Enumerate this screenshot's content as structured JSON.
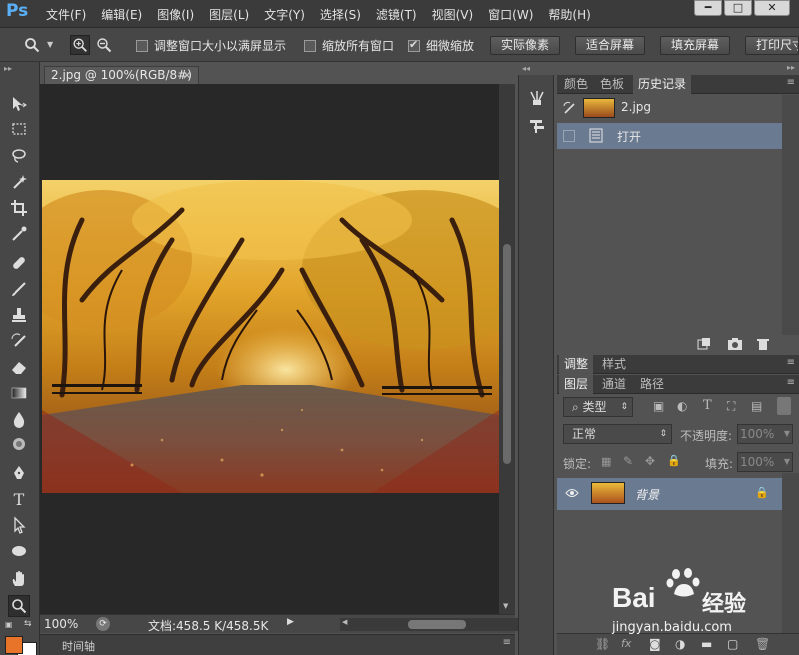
{
  "app": {
    "logo": "Ps"
  },
  "menu": [
    "文件(F)",
    "编辑(E)",
    "图像(I)",
    "图层(L)",
    "文字(Y)",
    "选择(S)",
    "滤镜(T)",
    "视图(V)",
    "窗口(W)",
    "帮助(H)"
  ],
  "window_controls": {
    "minimize": "━",
    "maximize": "□",
    "close": "✕"
  },
  "options": {
    "resize_windows": "调整窗口大小以满屏显示",
    "zoom_all": "缩放所有窗口",
    "scrubby_zoom": "细微缩放",
    "resize_checked": false,
    "zoom_all_checked": false,
    "scrubby_checked": true,
    "btn_actual": "实际像素",
    "btn_fit": "适合屏幕",
    "btn_fill": "填充屏幕",
    "btn_print": "打印尺寸"
  },
  "document": {
    "tab_title": "2.jpg @ 100%(RGB/8#)",
    "tab_close": "×",
    "zoom": "100%",
    "info": "文档:458.5 K/458.5K"
  },
  "timeline": {
    "label": "时间轴"
  },
  "history_panel": {
    "tabs": [
      "颜色",
      "色板",
      "历史记录"
    ],
    "snapshot_name": "2.jpg",
    "steps": [
      "打开"
    ]
  },
  "adjust_panel": {
    "tabs": [
      "调整",
      "样式"
    ]
  },
  "layers_panel": {
    "tabs": [
      "图层",
      "通道",
      "路径"
    ],
    "filter_kind": "类型",
    "blend_mode": "正常",
    "opacity_label": "不透明度:",
    "opacity_value": "100%",
    "lock_label": "锁定:",
    "fill_label": "填充:",
    "fill_value": "100%",
    "layers": [
      {
        "name": "背景",
        "locked": true,
        "visible": true
      }
    ]
  },
  "watermark": {
    "brand": "Bai",
    "brand2": "经验",
    "url": "jingyan.baidu.com"
  },
  "colors": {
    "foreground": "#e8742a",
    "background": "#ffffff",
    "selection": "#6a7a90"
  }
}
